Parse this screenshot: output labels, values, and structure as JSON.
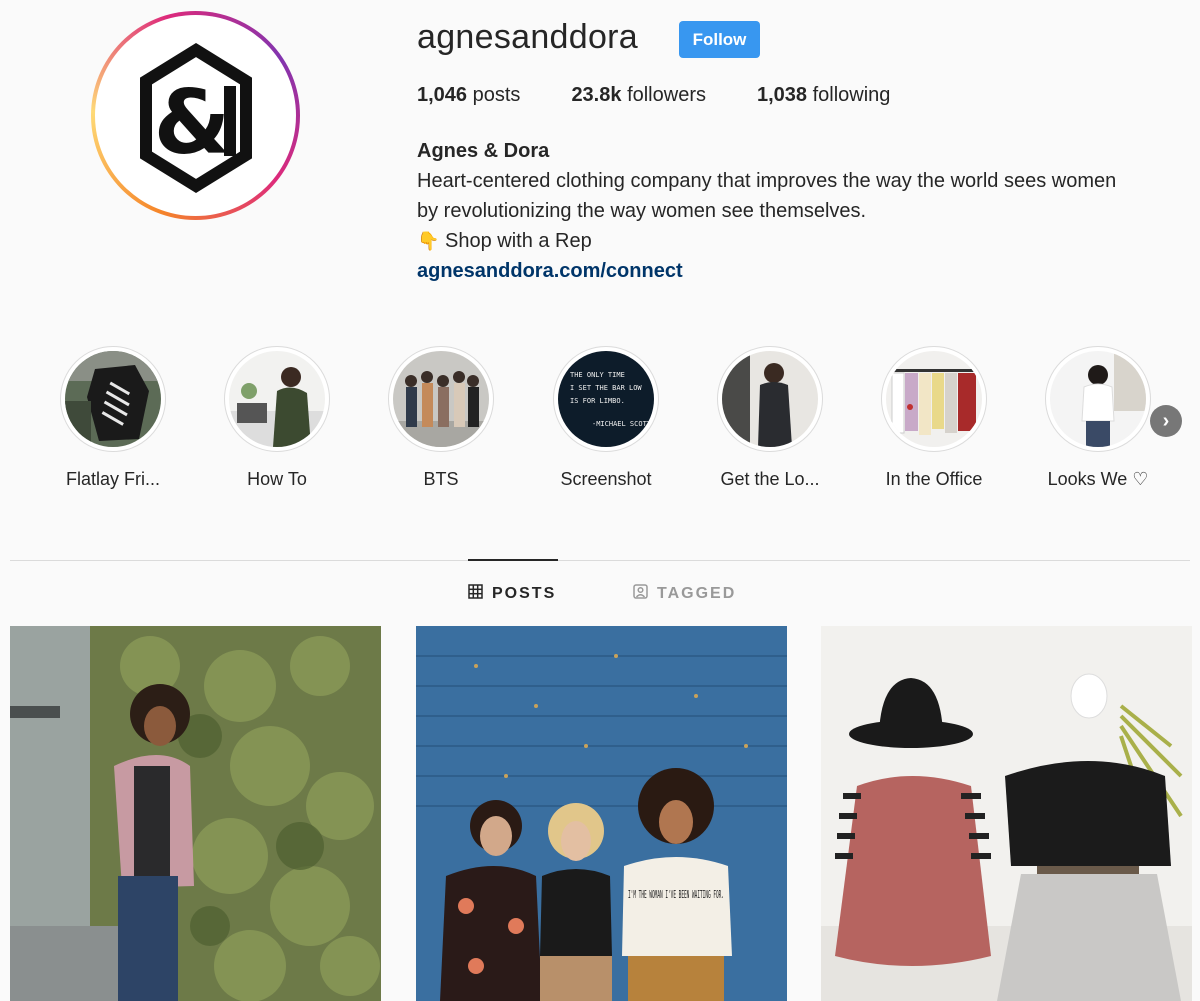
{
  "profile": {
    "username": "agnesanddora",
    "follow_label": "Follow",
    "stats": {
      "posts_count": "1,046",
      "posts_label": "posts",
      "followers_count": "23.8k",
      "followers_label": "followers",
      "following_count": "1,038",
      "following_label": "following"
    },
    "bio": {
      "name": "Agnes & Dora",
      "line1": "Heart-centered clothing company that improves the way the world sees women",
      "line2": "by revolutionizing the way women see themselves.",
      "emoji": "👇",
      "line3": "Shop with a Rep",
      "link": "agnesanddora.com/connect"
    }
  },
  "highlights": [
    {
      "label": "Flatlay Fri...",
      "image": "flatlay-shirt"
    },
    {
      "label": "How To",
      "image": "woman-laptop"
    },
    {
      "label": "BTS",
      "image": "group-photo"
    },
    {
      "label": "Screenshot",
      "image": "letter-board"
    },
    {
      "label": "Get the Lo...",
      "image": "woman-dress"
    },
    {
      "label": "In the Office",
      "image": "clothing-rack"
    },
    {
      "label": "Looks We ♡",
      "image": "woman-white-top"
    }
  ],
  "highlight_board": {
    "line1": "THE ONLY TIME",
    "line2": "I SET THE BAR LOW",
    "line3": "IS FOR LIMBO.",
    "line4": "-MICHAEL SCOTT"
  },
  "tabs": [
    {
      "label": "POSTS",
      "icon": "grid-icon",
      "active": true
    },
    {
      "label": "TAGGED",
      "icon": "tagged-icon",
      "active": false
    }
  ],
  "posts": [
    {
      "image": "woman-ivy-wall"
    },
    {
      "image": "three-women-blue-wall",
      "shirt_text": "I'M THE WOMAN I'VE BEEN WAITING FOR."
    },
    {
      "image": "mannequins-outfits"
    }
  ],
  "colors": {
    "follow": "#3897f0",
    "link": "#003569",
    "text": "#262626",
    "background": "#fafafa"
  }
}
